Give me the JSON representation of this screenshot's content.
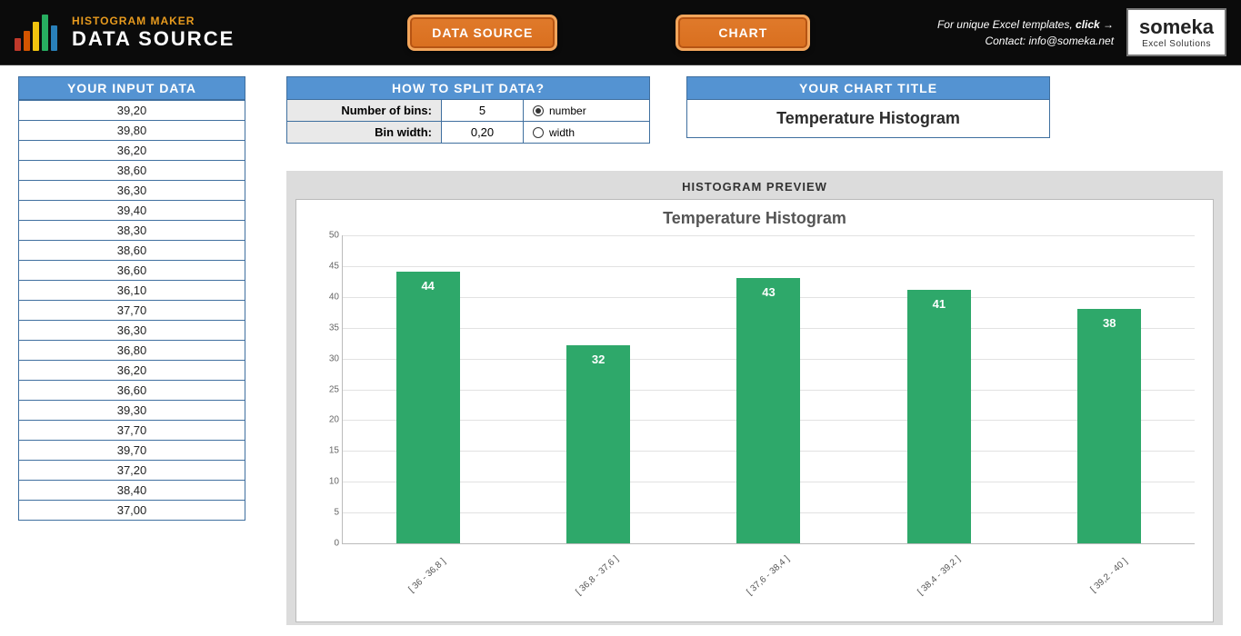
{
  "header": {
    "app_small": "HISTOGRAM MAKER",
    "app_big": "DATA SOURCE",
    "btn_data_source": "DATA SOURCE",
    "btn_chart": "CHART",
    "blurb_1_prefix": "For unique Excel templates, ",
    "blurb_1_link": "click →",
    "blurb_2_label": "Contact: ",
    "blurb_2_email": "info@someka.net",
    "brand_big": "someka",
    "brand_sub": "Excel Solutions"
  },
  "input": {
    "heading": "YOUR INPUT DATA",
    "values": [
      "39,20",
      "39,80",
      "36,20",
      "38,60",
      "36,30",
      "39,40",
      "38,30",
      "38,60",
      "36,60",
      "36,10",
      "37,70",
      "36,30",
      "36,80",
      "36,20",
      "36,60",
      "39,30",
      "37,70",
      "39,70",
      "37,20",
      "38,40",
      "37,00"
    ]
  },
  "split": {
    "heading": "HOW TO SPLIT DATA?",
    "row1_label": "Number of bins:",
    "row1_value": "5",
    "row1_radio": "number",
    "row2_label": "Bin width:",
    "row2_value": "0,20",
    "row2_radio": "width"
  },
  "titlepanel": {
    "heading": "YOUR CHART TITLE",
    "value": "Temperature Histogram"
  },
  "preview": {
    "heading": "HISTOGRAM PREVIEW",
    "chart_title": "Temperature Histogram"
  },
  "chart_data": {
    "type": "bar",
    "title": "Temperature Histogram",
    "categories": [
      "[ 36 - 36,8 ]",
      "[ 36,8 - 37,6 ]",
      "[ 37,6 - 38,4 ]",
      "[ 38,4 - 39,2 ]",
      "[ 39,2 - 40 ]"
    ],
    "values": [
      44,
      32,
      43,
      41,
      38
    ],
    "xlabel": "",
    "ylabel": "",
    "ylim": [
      0,
      50
    ],
    "ytick_step": 5,
    "bar_color": "#2ea86a"
  }
}
